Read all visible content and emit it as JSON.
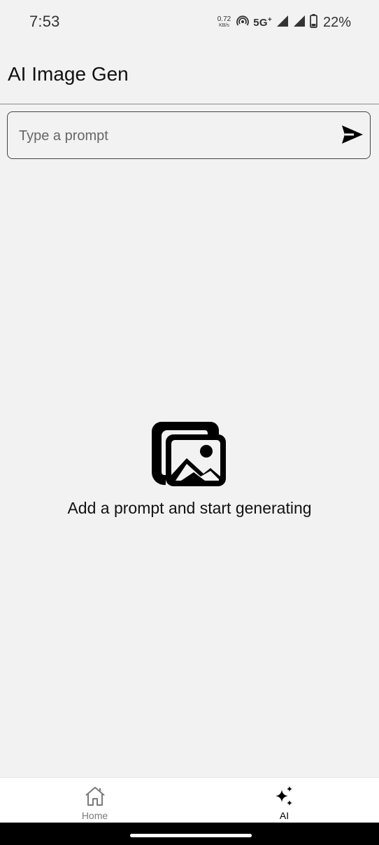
{
  "status_bar": {
    "time": "7:53",
    "speed_value": "0.72",
    "speed_unit": "KB/s",
    "network": "5G",
    "network_sup": "+",
    "battery_percent": "22%",
    "icons": [
      "hotspot-icon",
      "signal-icon",
      "signal-icon",
      "battery-icon"
    ]
  },
  "app_bar": {
    "title": "AI Image Gen"
  },
  "prompt": {
    "value": "",
    "placeholder": "Type a prompt",
    "send_icon": "send-icon"
  },
  "empty_state": {
    "icon": "image-gallery-icon",
    "message": "Add a prompt and start generating"
  },
  "bottom_nav": {
    "items": [
      {
        "label": "Home",
        "icon": "home-icon",
        "active": false
      },
      {
        "label": "AI",
        "icon": "sparkles-icon",
        "active": true
      }
    ]
  }
}
